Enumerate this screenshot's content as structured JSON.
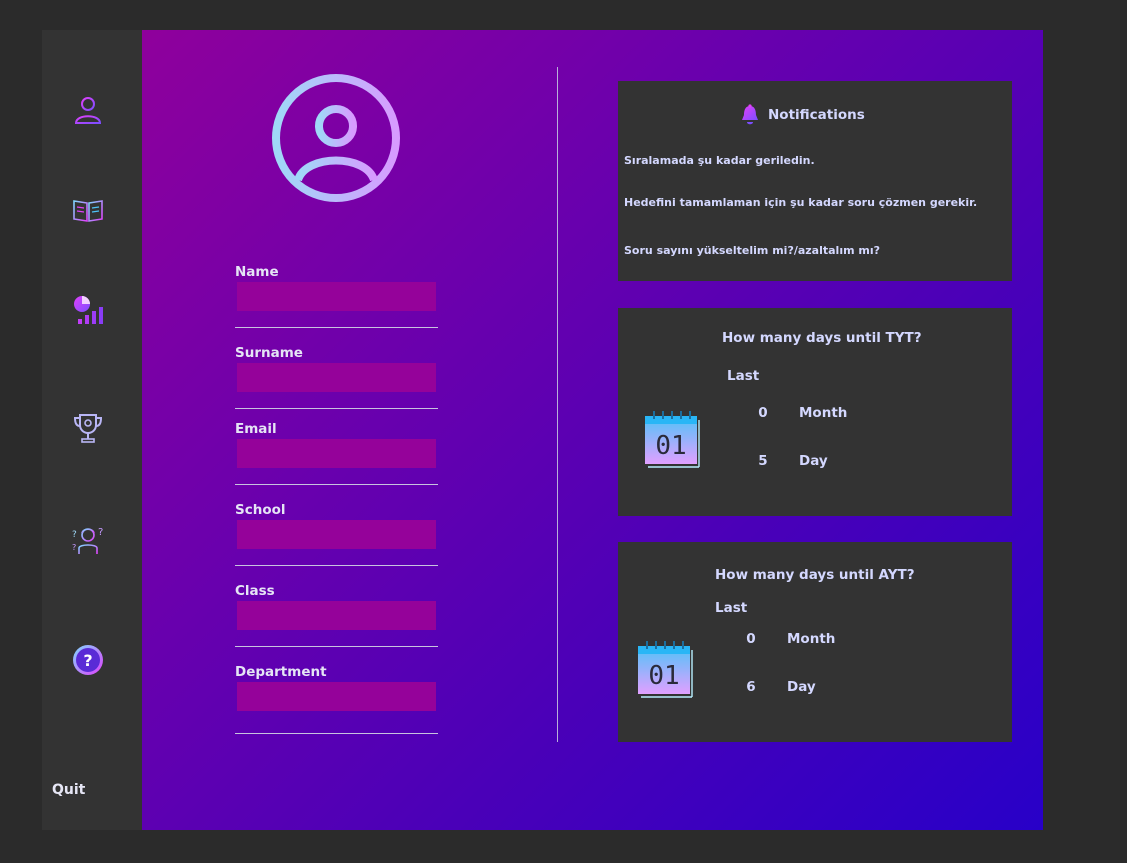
{
  "sidebar": {
    "items": [
      {
        "icon": "user-icon"
      },
      {
        "icon": "book-icon"
      },
      {
        "icon": "stats-icon"
      },
      {
        "icon": "trophy-icon"
      },
      {
        "icon": "question-person-icon"
      },
      {
        "icon": "help-icon"
      }
    ],
    "quit_label": "Quit"
  },
  "profile": {
    "avatar_icon": "profile-avatar-icon",
    "fields": [
      {
        "label": "Name",
        "value": ""
      },
      {
        "label": "Surname",
        "value": ""
      },
      {
        "label": "Email",
        "value": ""
      },
      {
        "label": "School",
        "value": ""
      },
      {
        "label": "Class",
        "value": ""
      },
      {
        "label": "Department",
        "value": ""
      }
    ]
  },
  "notifications": {
    "title": "Notifications",
    "icon": "bell-icon",
    "messages": [
      "Sıralamada şu kadar geriledin.",
      "Hedefini tamamlaman için şu kadar soru çözmen gerekir.",
      "Soru sayını yükseltelim mi?/azaltalım mı?"
    ]
  },
  "tyt": {
    "title": "How many days until TYT?",
    "last_label": "Last",
    "month_value": "0",
    "month_label": "Month",
    "day_value": "5",
    "day_label": "Day",
    "calendar_text": "01"
  },
  "ayt": {
    "title": "How many days until AYT?",
    "last_label": "Last",
    "month_value": "0",
    "month_label": "Month",
    "day_value": "6",
    "day_label": "Day",
    "calendar_text": "01"
  },
  "colors": {
    "sidebar_bg": "#333333",
    "panel_bg": "#333333",
    "input_bg": "#95029a",
    "gradient_start": "#8f009c",
    "gradient_end": "#2800c8",
    "text": "#d4d8ff"
  }
}
